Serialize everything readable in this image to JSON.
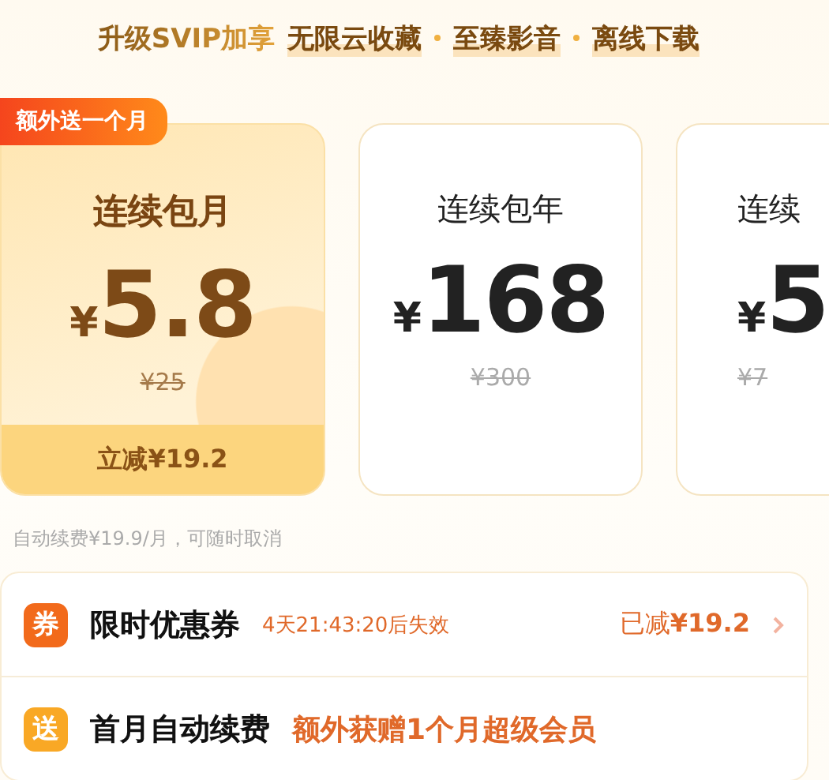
{
  "header": {
    "lead": "升级SVIP加享",
    "features": [
      "无限云收藏",
      "至臻影音",
      "离线下载"
    ]
  },
  "plans": [
    {
      "name": "连续包月",
      "currency": "¥",
      "amount": "5.8",
      "original": "¥25",
      "badge": "额外送一个月",
      "discount": "立减¥19.2",
      "selected": true
    },
    {
      "name": "连续包年",
      "currency": "¥",
      "amount": "168",
      "original": "¥300",
      "selected": false
    },
    {
      "name": "连续",
      "currency": "¥",
      "amount": "5",
      "original": "¥7",
      "selected": false
    }
  ],
  "note": "自动续费¥19.9/月，可随时取消",
  "offers": [
    {
      "kind": "coupon",
      "icon": "券",
      "color": "#f26a1b",
      "title": "限时优惠券",
      "detail": "4天21:43:20后失效",
      "value": "已减**¥19.2**"
    },
    {
      "kind": "gift",
      "icon": "送",
      "color": "#f9a825",
      "title": "首月自动续费",
      "detail": "额外获赠1个月超级会员"
    }
  ]
}
